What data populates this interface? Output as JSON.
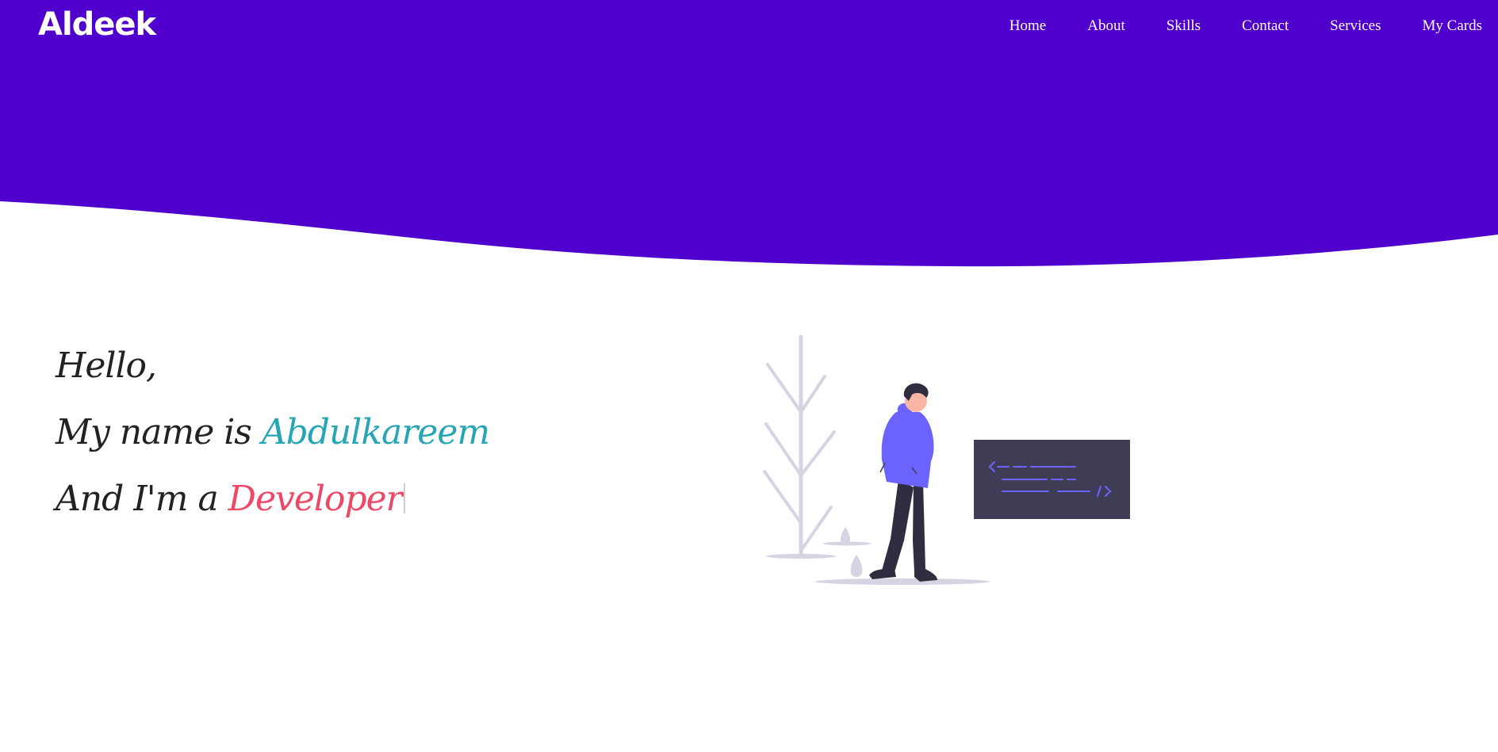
{
  "brand": {
    "logo_text": "Aldeek"
  },
  "nav": {
    "items": [
      {
        "label": "Home"
      },
      {
        "label": "About"
      },
      {
        "label": "Skills"
      },
      {
        "label": "Contact"
      },
      {
        "label": "Services"
      },
      {
        "label": "My Cards"
      }
    ]
  },
  "hero": {
    "greeting": "Hello,",
    "name_prefix": "My name is ",
    "name": "Abdulkareem",
    "role_prefix": "And I'm a ",
    "role": "Developer"
  },
  "colors": {
    "header_bg": "#5000cc",
    "name_accent": "#26a5b5",
    "role_accent": "#ef4867",
    "hoodie": "#6c63ff",
    "code_panel": "#3f3d56"
  },
  "illustration": {
    "icon": "developer-illustration",
    "panel_icon": "code-tag-icon"
  }
}
